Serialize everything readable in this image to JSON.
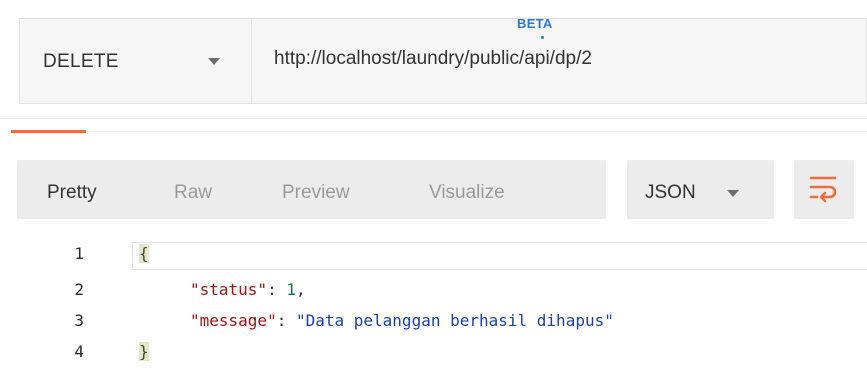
{
  "request": {
    "method": "DELETE",
    "url": "http://localhost/laundry/public/api/dp/2"
  },
  "response_view": {
    "tabs": [
      {
        "label": "Pretty",
        "active": true
      },
      {
        "label": "Raw",
        "active": false
      },
      {
        "label": "Preview",
        "active": false
      },
      {
        "label": "Visualize",
        "active": false
      }
    ],
    "beta_badge": "BETA",
    "format": "JSON",
    "wrap_icon": "wrap-lines-icon"
  },
  "code": {
    "line_numbers": [
      "1",
      "2",
      "3",
      "4"
    ],
    "open_brace": "{",
    "close_brace": "}",
    "status_key": "\"status\"",
    "status_value": "1",
    "message_key": "\"message\"",
    "message_value": "\"Data pelanggan berhasil dihapus\""
  },
  "colors": {
    "accent_orange": "#f26b3a",
    "beta_blue": "#2e79d6",
    "json_key": "#a31515",
    "json_string": "#1c3fa8",
    "json_number": "#0b7a3e"
  }
}
